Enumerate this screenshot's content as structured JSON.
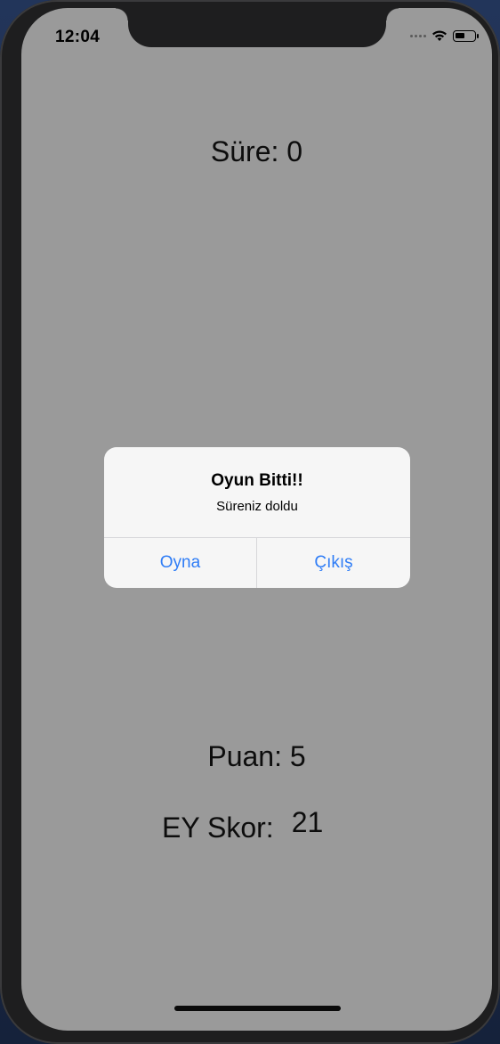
{
  "status_bar": {
    "time": "12:04",
    "icons": [
      "signal-dots-icon",
      "wifi-icon",
      "battery-icon"
    ],
    "battery_level": 0.55
  },
  "game": {
    "timer_text": "Süre: 0",
    "score_text": "Puan: 5",
    "highscore_label": "EY Skor:",
    "highscore_value": "21"
  },
  "alert": {
    "title": "Oyun Bitti!!",
    "message": "Süreniz doldu",
    "actions": [
      {
        "label": "Oyna"
      },
      {
        "label": "Çıkış"
      }
    ]
  },
  "colors": {
    "screen_background": "#9a9a9a",
    "alert_background": "#f6f6f6",
    "action_tint": "#2f7df6"
  }
}
